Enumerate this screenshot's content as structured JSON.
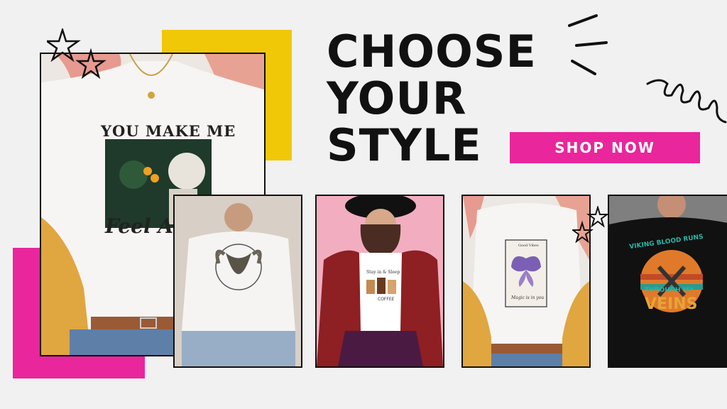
{
  "banner": {
    "headline_lines": [
      "CHOOSE",
      "YOUR",
      "STYLE"
    ],
    "cta_label": "SHOP NOW"
  },
  "colors": {
    "accent_pink": "#e9269b",
    "accent_yellow": "#f0c808",
    "ink": "#111111"
  },
  "hero_shirt": {
    "print_top": "YOU MAKE ME",
    "print_bottom": "Feel A"
  },
  "products": [
    {
      "shirt_color": "white",
      "design": "goat-head-graphic"
    },
    {
      "shirt_color": "white",
      "design": "coffee-cups-graphic",
      "print_top": "Stay in & Sleep",
      "print_bottom": "COFFEE"
    },
    {
      "shirt_color": "white",
      "design": "butterfly-tarot-card",
      "card_top": "Good Vibes",
      "card_bottom": "Magic is in you"
    },
    {
      "shirt_color": "black",
      "design": "viking-sunset-graphic",
      "print_top": "VIKING BLOOD RUNS",
      "print_mid": "THROUGH MY",
      "print_bottom": "VEINS"
    }
  ]
}
